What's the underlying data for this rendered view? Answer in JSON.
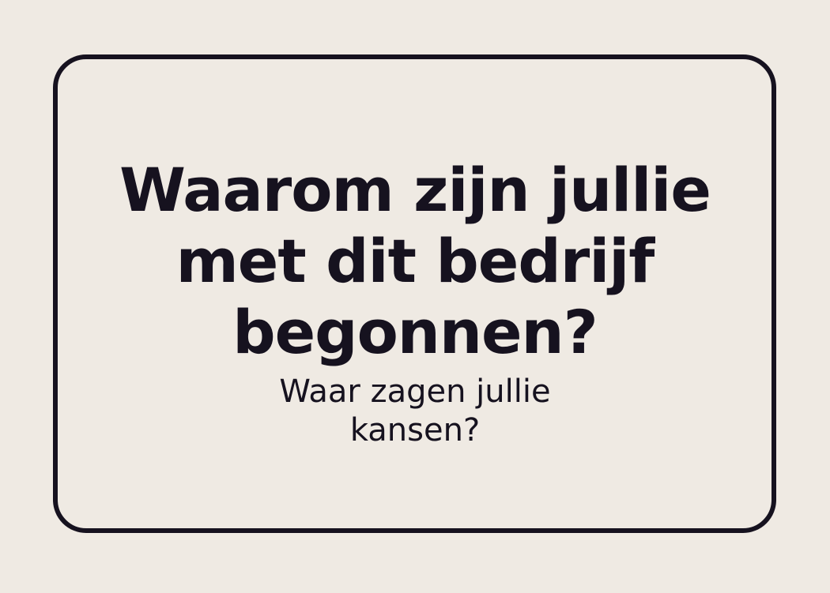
{
  "card": {
    "question_lines": [
      "Waarom zijn jullie",
      "met dit bedrijf",
      "begonnen?"
    ],
    "sub_question_lines": [
      "Waar zagen jullie",
      "kansen?"
    ]
  },
  "colors": {
    "background": "#efeae3",
    "ink": "#16121f"
  }
}
